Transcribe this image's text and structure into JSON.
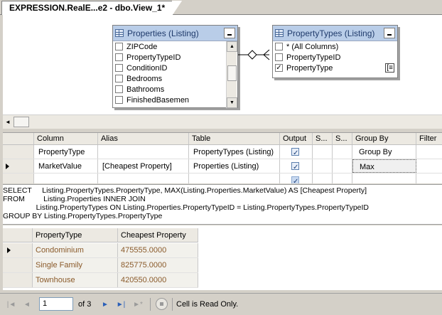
{
  "tab": {
    "title": "EXPRESSION.RealE...e2 - dbo.View_1*"
  },
  "diagram": {
    "properties_table": {
      "title": "Properties (Listing)",
      "columns": [
        "ZIPCode",
        "PropertyTypeID",
        "ConditionID",
        "Bedrooms",
        "Bathrooms",
        "FinishedBasemen"
      ]
    },
    "property_types_table": {
      "title": "PropertyTypes (Listing)",
      "columns": [
        {
          "label": "* (All Columns)",
          "checked": false
        },
        {
          "label": "PropertyTypeID",
          "checked": false
        },
        {
          "label": "PropertyType",
          "checked": true
        }
      ],
      "group_icon": "[≡"
    }
  },
  "criteria": {
    "headers": [
      "Column",
      "Alias",
      "Table",
      "Output",
      "S...",
      "S...",
      "Group By",
      "Filter"
    ],
    "rows": [
      {
        "column": "PropertyType",
        "alias": "",
        "table": "PropertyTypes (Listing)",
        "output": true,
        "group_by": "Group By"
      },
      {
        "column": "MarketValue",
        "alias": "[Cheapest Property]",
        "table": "Properties (Listing)",
        "output": true,
        "group_by": "Max"
      }
    ]
  },
  "sql": {
    "lines": [
      "SELECT     Listing.PropertyTypes.PropertyType, MAX(Listing.Properties.MarketValue) AS [Cheapest Property]",
      "FROM         Listing.Properties INNER JOIN",
      "                Listing.PropertyTypes ON Listing.Properties.PropertyTypeID = Listing.PropertyTypes.PropertyTypeID",
      "GROUP BY Listing.PropertyTypes.PropertyType"
    ]
  },
  "results": {
    "headers": [
      "PropertyType",
      "Cheapest Property"
    ],
    "rows": [
      [
        "Condominium",
        "475555.0000"
      ],
      [
        "Single Family",
        "825775.0000"
      ],
      [
        "Townhouse",
        "420550.0000"
      ]
    ]
  },
  "navigator": {
    "current": "1",
    "of_text": "of 3",
    "status": "Cell is Read Only."
  }
}
